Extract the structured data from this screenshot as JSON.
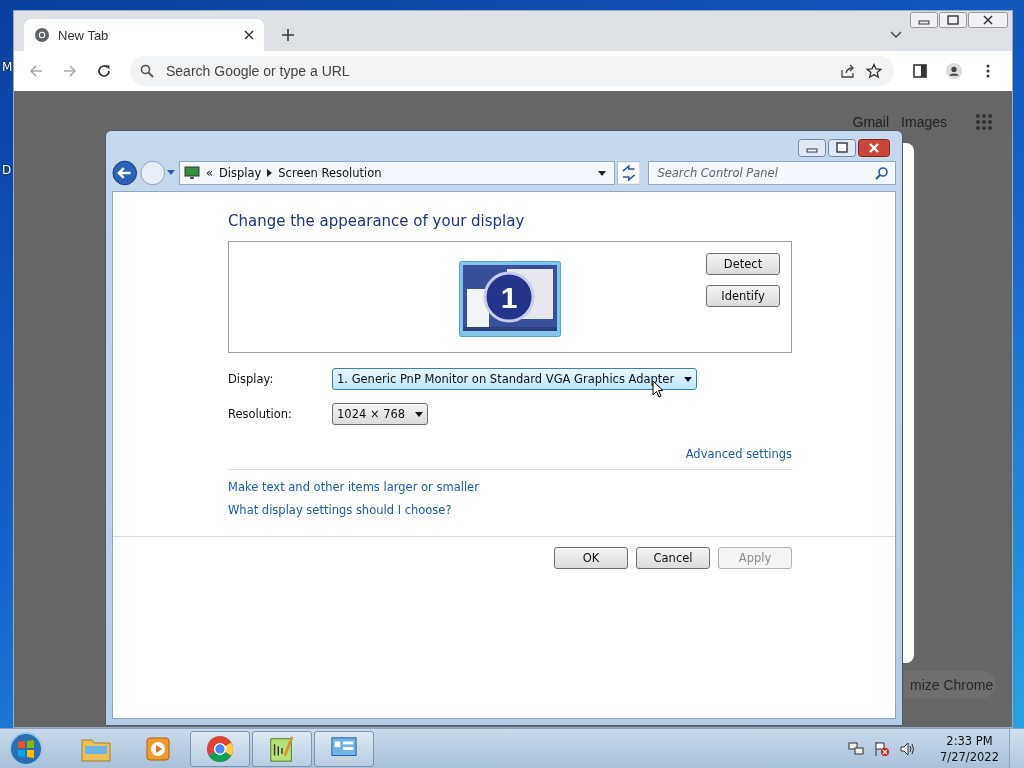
{
  "desktop": {
    "icon_labels": [
      "M",
      "D"
    ]
  },
  "browser": {
    "tab": {
      "title": "New Tab"
    },
    "omnibox": {
      "placeholder": "Search Google or type a URL"
    },
    "header_links": [
      "Gmail",
      "Images"
    ],
    "customize_button": "mize Chrome"
  },
  "dialog": {
    "breadcrumb": {
      "overflow": "«",
      "items": [
        "Display",
        "Screen Resolution"
      ]
    },
    "search": {
      "placeholder": "Search Control Panel"
    },
    "heading": "Change the appearance of your display",
    "monitor_number": "1",
    "side_buttons": [
      {
        "label": "Detect"
      },
      {
        "label": "Identify"
      }
    ],
    "fields": [
      {
        "label": "Display:",
        "value": "1. Generic PnP Monitor on Standard VGA Graphics Adapter",
        "focused": true
      },
      {
        "label": "Resolution:",
        "value": "1024 × 768",
        "focused": false
      }
    ],
    "advanced_link": "Advanced settings",
    "links": [
      "Make text and other items larger or smaller",
      "What display settings should I choose?"
    ],
    "footer_buttons": [
      {
        "label": "OK",
        "disabled": false
      },
      {
        "label": "Cancel",
        "disabled": false
      },
      {
        "label": "Apply",
        "disabled": true
      }
    ]
  },
  "taskbar": {
    "apps": [
      {
        "kind": "folder",
        "running": false
      },
      {
        "kind": "media",
        "running": false
      },
      {
        "kind": "chrome",
        "running": true
      },
      {
        "kind": "notepad",
        "running": true
      },
      {
        "kind": "display",
        "running": true
      }
    ],
    "clock": {
      "time": "2:33 PM",
      "date": "7/27/2022"
    }
  }
}
